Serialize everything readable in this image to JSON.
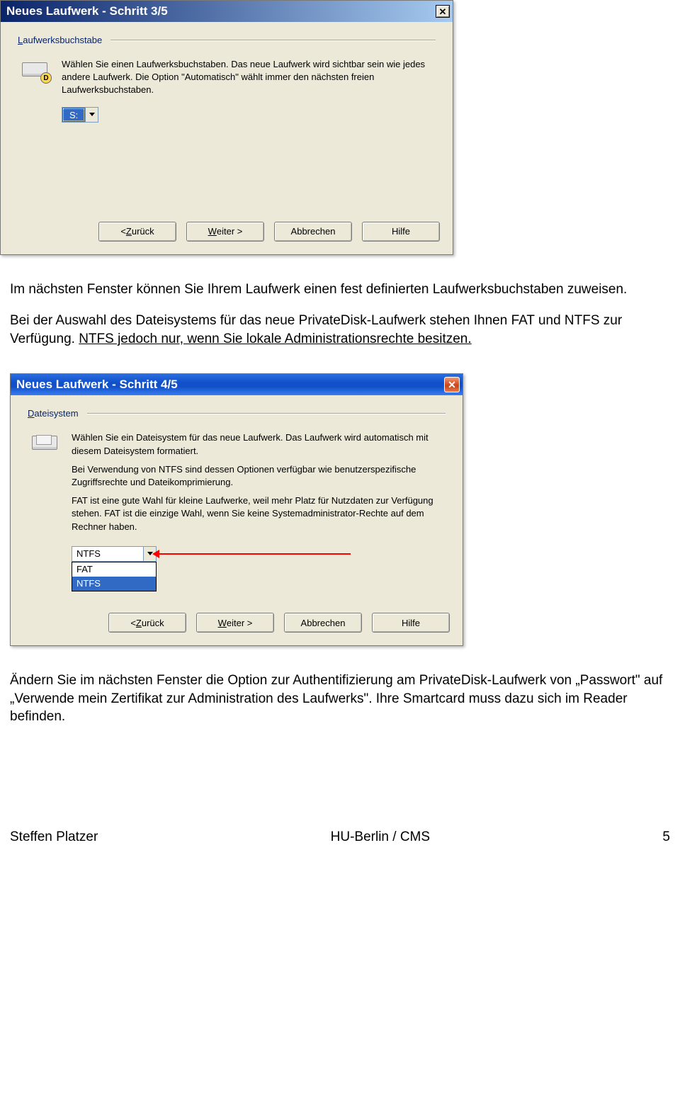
{
  "dialog1": {
    "title": "Neues Laufwerk - Schritt 3/5",
    "group_label_u": "L",
    "group_label_rest": "aufwerksbuchstabe",
    "desc": "Wählen Sie einen Laufwerksbuchstaben. Das neue Laufwerk wird sichtbar sein wie jedes andere Laufwerk. Die Option \"Automatisch\" wählt immer den nächsten freien Laufwerksbuchstaben.",
    "selected": "S:",
    "icon_badge": "D"
  },
  "buttons": {
    "back_pre": "< ",
    "back_u": "Z",
    "back_rest": "urück",
    "next_u": "W",
    "next_rest": "eiter >",
    "cancel": "Abbrechen",
    "help": "Hilfe"
  },
  "para1": {
    "p1": "Im nächsten Fenster können Sie Ihrem Laufwerk einen fest definierten Laufwerksbuchstaben zuweisen.",
    "p2a": "Bei der Auswahl des Dateisystems für das neue PrivateDisk-Laufwerk stehen Ihnen FAT und NTFS zur Verfügung. ",
    "p2u": "NTFS jedoch nur, wenn Sie lokale Administrationsrechte besitzen."
  },
  "dialog2": {
    "title": "Neues Laufwerk - Schritt 4/5",
    "group_label_u": "D",
    "group_label_rest": "ateisystem",
    "desc1": "Wählen Sie ein Dateisystem für das neue Laufwerk. Das Laufwerk wird automatisch mit diesem Dateisystem formatiert.",
    "desc2": "Bei Verwendung von NTFS sind dessen Optionen verfügbar wie benutzerspezifische Zugriffsrechte und Dateikomprimierung.",
    "desc3": "FAT ist eine gute Wahl für kleine Laufwerke, weil mehr Platz für Nutzdaten zur Verfügung stehen. FAT ist die einzige Wahl, wenn Sie keine Systemadministrator-Rechte auf dem Rechner haben.",
    "field_value": "NTFS",
    "opt1": "FAT",
    "opt2": "NTFS"
  },
  "para2": "Ändern Sie im nächsten Fenster die Option zur Authentifizierung am PrivateDisk-Laufwerk von „Passwort\" auf „Verwende mein Zertifikat zur Administration des Laufwerks\". Ihre Smartcard muss dazu sich im Reader befinden.",
  "footer": {
    "left": "Steffen Platzer",
    "center": "HU-Berlin / CMS",
    "right": "5"
  }
}
